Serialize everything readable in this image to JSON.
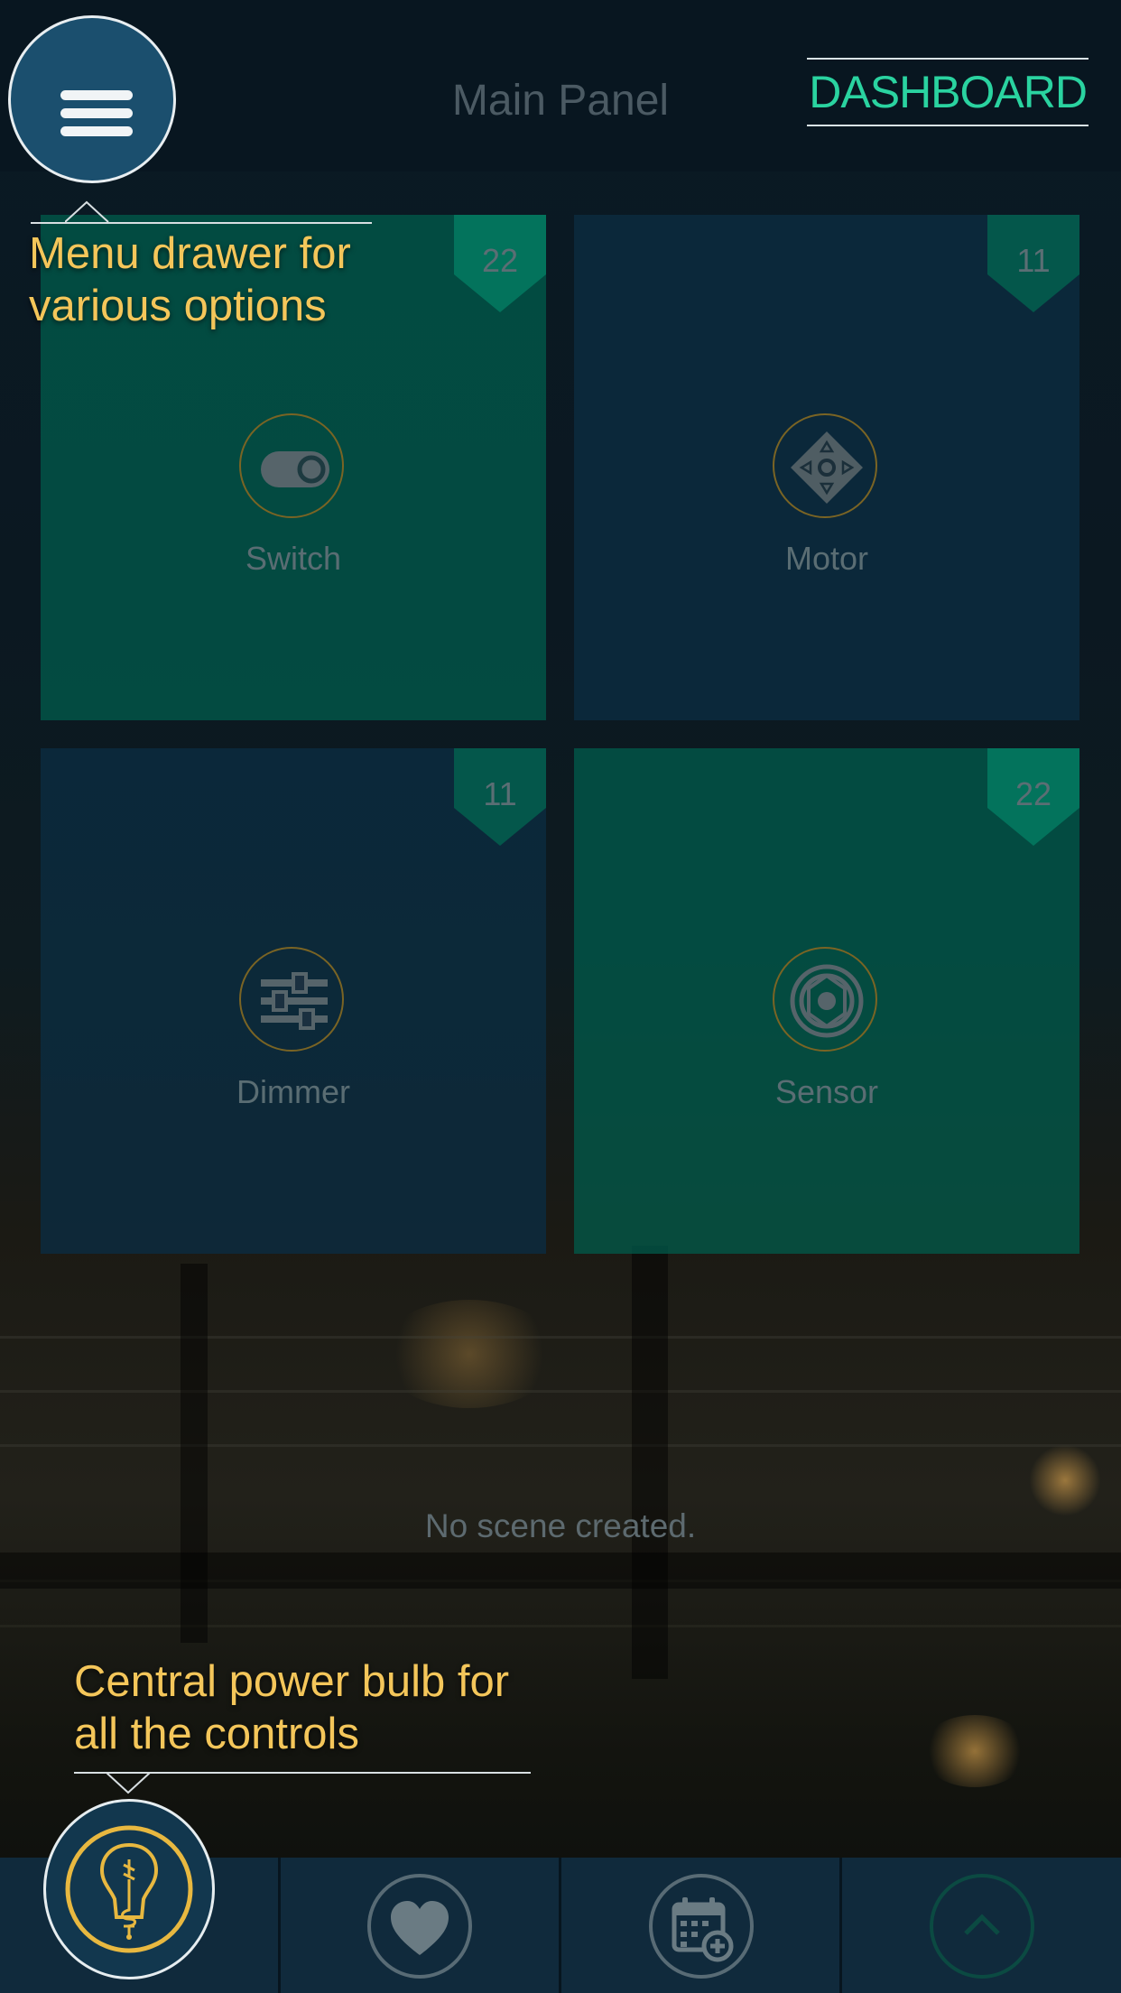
{
  "header": {
    "title": "Main Panel",
    "dashboard_label": "DASHBOARD",
    "menu_icon": "hamburger-icon"
  },
  "tiles": [
    {
      "label": "Switch",
      "count": "22",
      "icon": "toggle-icon",
      "color": "#005e4e"
    },
    {
      "label": "Motor",
      "count": "11",
      "icon": "motor-directional-icon",
      "color": "#0c2c3e"
    },
    {
      "label": "Dimmer",
      "count": "11",
      "icon": "sliders-icon",
      "color": "#0c2c3e"
    },
    {
      "label": "Sensor",
      "count": "22",
      "icon": "sensor-aperture-icon",
      "color": "#005e4e"
    }
  ],
  "scenes": {
    "empty_message": "No scene created."
  },
  "tooltips": {
    "menu_line1": "Menu drawer for",
    "menu_line2": "various options",
    "bulb_line1": "Central power bulb for",
    "bulb_line2": "all the controls"
  },
  "bottom_bar": {
    "items": [
      {
        "icon": "lightbulb-icon"
      },
      {
        "icon": "heart-icon"
      },
      {
        "icon": "calendar-add-icon"
      },
      {
        "icon": "chevron-up-icon"
      }
    ]
  },
  "colors": {
    "accent_green": "#2ad3a0",
    "tooltip_yellow": "#f4c65a",
    "icon_gold": "#e8b840"
  }
}
